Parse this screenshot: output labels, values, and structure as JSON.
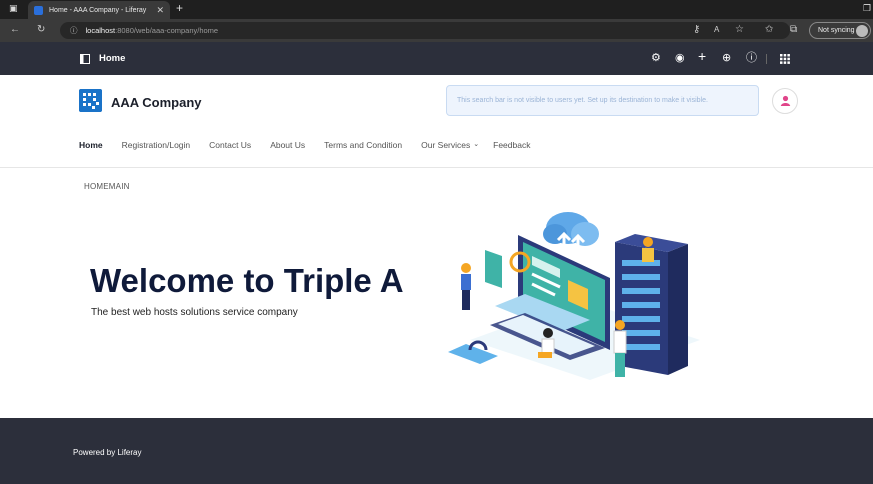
{
  "browser": {
    "tab_title": "Home - AAA Company - Liferay",
    "url_host": "localhost",
    "url_rest": ":8080/web/aaa-company/home",
    "sync_label": "Not syncing"
  },
  "control_menu": {
    "title": "Home"
  },
  "site": {
    "name": "AAA Company",
    "search_placeholder": "This search bar is not visible to users yet. Set up its destination to make it visible."
  },
  "nav": {
    "items": [
      {
        "label": "Home",
        "active": true
      },
      {
        "label": "Registration/Login"
      },
      {
        "label": "Contact Us"
      },
      {
        "label": "About Us"
      },
      {
        "label": "Terms and Condition"
      },
      {
        "label": "Our Services"
      },
      {
        "label": "Feedback"
      }
    ]
  },
  "breadcrumb": "HOMEMAIN",
  "hero": {
    "title": "Welcome to Triple A",
    "subtitle": "The best web hosts solutions service company"
  },
  "footer": {
    "powered": "Powered by Liferay"
  },
  "colors": {
    "brand": "#1a73c8",
    "dark": "#2c2f3b",
    "headline": "#0f1a3a"
  }
}
